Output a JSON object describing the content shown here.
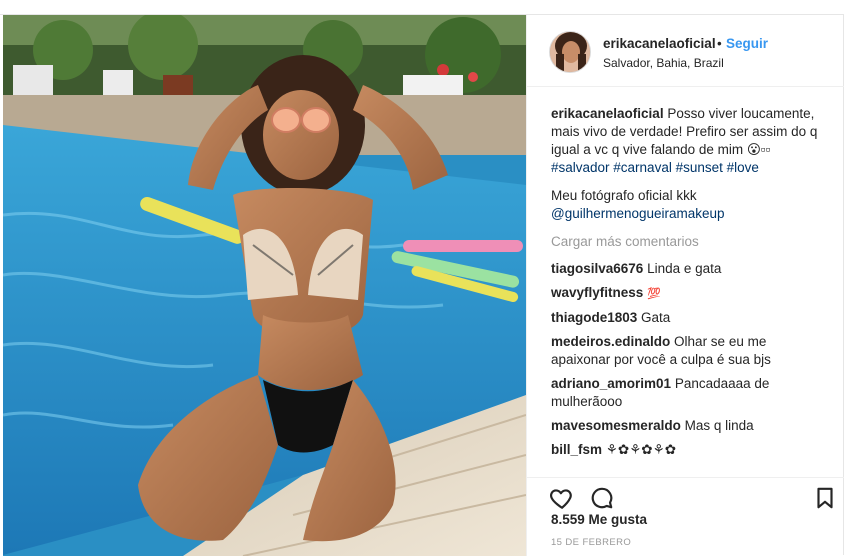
{
  "post": {
    "username": "erikacanelaoficial",
    "separator": "•",
    "follow_label": "Seguir",
    "location": "Salvador, Bahia, Brazil",
    "caption": {
      "username": "erikacanelaoficial",
      "text": "Posso viver loucamente, mais vivo de verdade! Prefiro ser assim do q igual a vc q vive falando de mim 😮▫▫",
      "hashtags": "#salvador #carnaval #sunset #love",
      "line2": "Meu fotógrafo oficial kkk",
      "mention": "@guilhermenogueiramakeup"
    },
    "load_more": "Cargar más comentarios",
    "comments": [
      {
        "user": "tiagosilva6676",
        "text": "Linda e gata"
      },
      {
        "user": "wavyflyfitness",
        "text": "💯"
      },
      {
        "user": "thiagode1803",
        "text": "Gata"
      },
      {
        "user": "medeiros.edinaldo",
        "text": "Olhar se eu me apaixonar por você a culpa é sua bjs"
      },
      {
        "user": "adriano_amorim01",
        "text": "Pancadaaaa de mulherãooo"
      },
      {
        "user": "mavesomesmeraldo",
        "text": "Mas q linda"
      },
      {
        "user": "bill_fsm",
        "text": "⚘✿⚘✿⚘✿"
      }
    ],
    "likes": "8.559 Me gusta",
    "date": "15 DE FEBRERO",
    "icons": {
      "like": "heart-icon",
      "comment": "comment-icon",
      "save": "bookmark-icon"
    },
    "colors": {
      "link": "#3897f0",
      "hashtag": "#003569",
      "muted": "#999999",
      "border": "#efefef"
    }
  }
}
